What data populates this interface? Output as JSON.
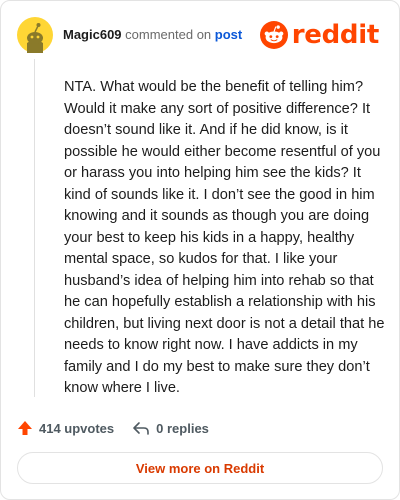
{
  "comment": {
    "author": "Magic609",
    "action_text": "commented on",
    "post_link_label": "post",
    "body": "NTA. What would be the benefit of telling him? Would it make any sort of positive difference? It doesn’t sound like it. And if he did know, is it possible he would either become resentful of you or harass you into helping him see the kids? It kind of sounds like it. I don’t see the good in him knowing and it sounds as though you are doing your best to keep his kids in a happy, healthy mental space, so kudos for that. I like your husband’s idea of helping him into rehab so that he can hopefully establish a relationship with his children, but living next door is not a detail that he needs to know right now. I have addicts in my family and I do my best to make sure they don’t know where I live."
  },
  "brand": {
    "logo_text": "reddit",
    "accent_color": "#ff4500"
  },
  "stats": {
    "upvotes_label": "414 upvotes",
    "replies_label": "0 replies"
  },
  "footer": {
    "view_more_label": "View more on Reddit"
  },
  "icons": {
    "avatar": "snoo-avatar-icon",
    "logo": "reddit-snoo-logo-icon",
    "upvote": "upvote-arrow-icon",
    "reply": "reply-arrow-icon"
  }
}
